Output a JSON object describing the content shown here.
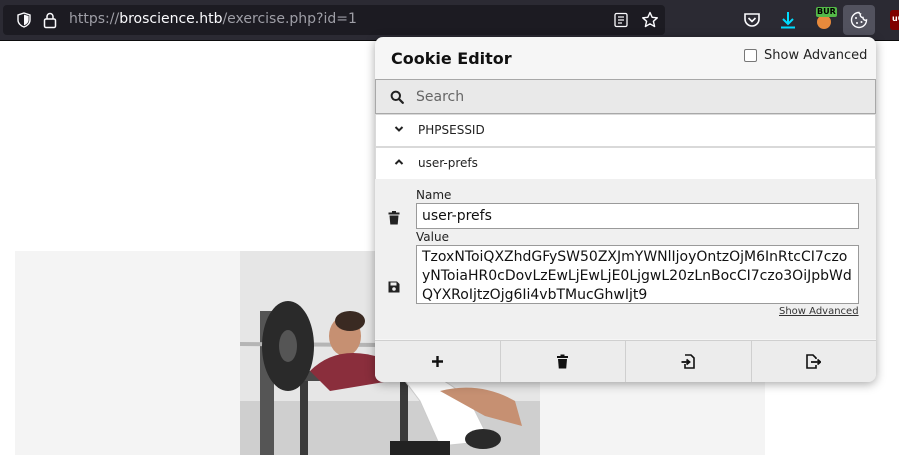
{
  "browser": {
    "url_prefix": "https://",
    "url_host": "broscience.htb",
    "url_path": "/exercise.php?id=1",
    "burp_badge": "BUR",
    "ublock_badge": "uO"
  },
  "cookie_editor": {
    "title": "Cookie Editor",
    "show_advanced_label": "Show Advanced",
    "show_advanced_checked": false,
    "search_placeholder": "Search",
    "cookies": [
      {
        "name": "PHPSESSID",
        "expanded": false,
        "chevron": "chevron-down-icon"
      },
      {
        "name": "user-prefs",
        "expanded": true,
        "chevron": "chevron-up-icon"
      }
    ],
    "detail": {
      "name_label": "Name",
      "name_value": "user-prefs",
      "value_label": "Value",
      "value_text": "TzoxNToiQXZhdGFySW50ZXJmYWNlIjoyOntzOjM6InRtcCI7czoyNToiaHR0cDovLzEwLjEwLjE0LjgwL20zLnBocCI7czo3OiJpbWdQYXRoIjtzOjg6Ii4vbTMucGhwIjt9",
      "show_advanced_link": "Show Advanced"
    },
    "footer_actions": [
      {
        "name": "add",
        "icon": "plus-icon"
      },
      {
        "name": "delete-all",
        "icon": "trash-icon"
      },
      {
        "name": "import",
        "icon": "import-icon"
      },
      {
        "name": "export",
        "icon": "export-icon"
      }
    ]
  },
  "colors": {
    "toolbar_bg": "#2b2a33",
    "urlbar_bg": "#1c1b22",
    "popup_bg": "#f6f6f6",
    "burp_badge": "#54b948"
  }
}
